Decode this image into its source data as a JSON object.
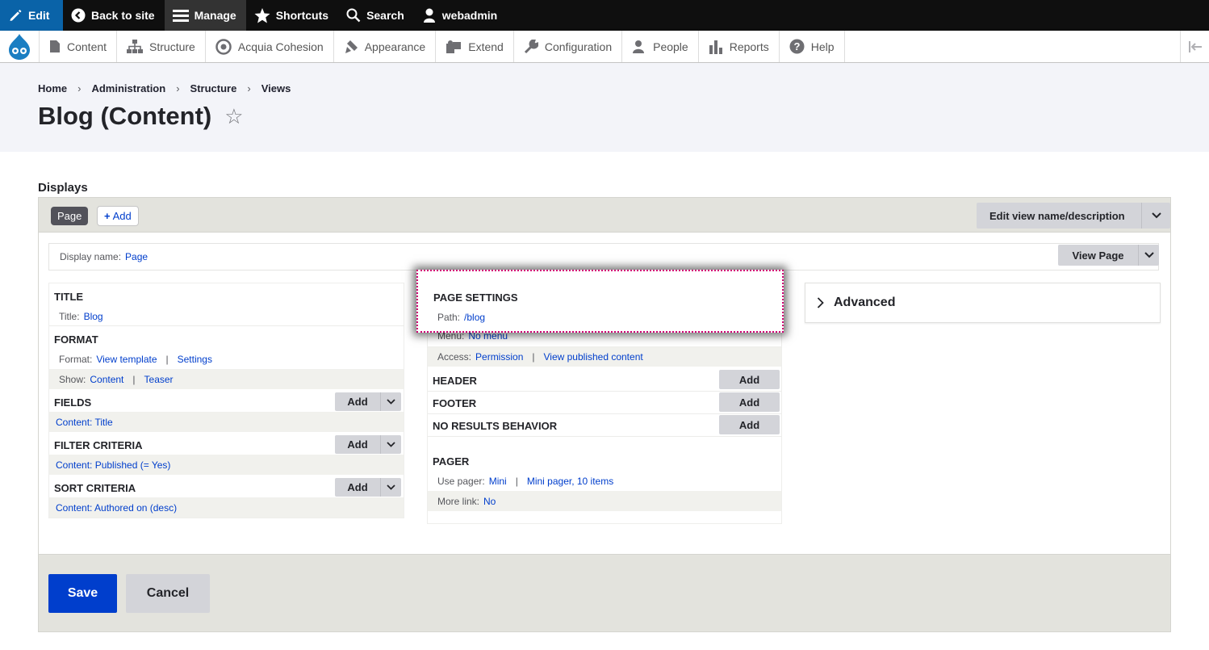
{
  "toolbar": {
    "edit": "Edit",
    "back_to_site": "Back to site",
    "manage": "Manage",
    "shortcuts": "Shortcuts",
    "search": "Search",
    "user": "webadmin"
  },
  "tray": {
    "items": [
      "Content",
      "Structure",
      "Acquia Cohesion",
      "Appearance",
      "Extend",
      "Configuration",
      "People",
      "Reports",
      "Help"
    ]
  },
  "breadcrumb": [
    "Home",
    "Administration",
    "Structure",
    "Views"
  ],
  "page_title": "Blog (Content)",
  "displays_label": "Displays",
  "tabs": {
    "page": "Page",
    "add": "Add",
    "edit_view_name": "Edit view name/description"
  },
  "display_name": {
    "label": "Display name:",
    "value": "Page",
    "view_page": "View Page"
  },
  "left": {
    "title_h": "TITLE",
    "title_label": "Title:",
    "title_value": "Blog",
    "format_h": "FORMAT",
    "format_label": "Format:",
    "format_value": "View template",
    "format_settings": "Settings",
    "show_label": "Show:",
    "show_value": "Content",
    "show_settings": "Teaser",
    "fields_h": "FIELDS",
    "fields_item": "Content: Title",
    "filter_h": "FILTER CRITERIA",
    "filter_item": "Content: Published (= Yes)",
    "sort_h": "SORT CRITERIA",
    "sort_item": "Content: Authored on (desc)",
    "add": "Add"
  },
  "mid": {
    "page_settings_h": "PAGE SETTINGS",
    "path_label": "Path:",
    "path_value": "/blog",
    "menu_label": "Menu:",
    "menu_value": "No menu",
    "access_label": "Access:",
    "access_value": "Permission",
    "access_settings": "View published content",
    "header_h": "HEADER",
    "footer_h": "FOOTER",
    "no_results_h": "NO RESULTS BEHAVIOR",
    "pager_h": "PAGER",
    "use_pager_label": "Use pager:",
    "use_pager_value": "Mini",
    "use_pager_settings": "Mini pager, 10 items",
    "more_link_label": "More link:",
    "more_link_value": "No",
    "add": "Add"
  },
  "right": {
    "advanced": "Advanced"
  },
  "actions": {
    "save": "Save",
    "cancel": "Cancel"
  },
  "colors": {
    "toolbar_bg": "#0f0f0f",
    "edit_bg": "#0a63a8",
    "primary": "#003ecc",
    "highlight_border": "#d10074"
  }
}
